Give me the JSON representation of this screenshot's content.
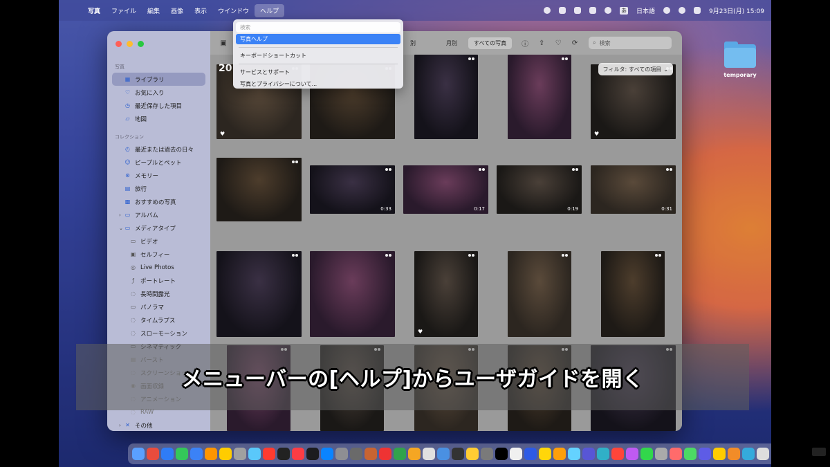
{
  "menubar": {
    "items": [
      {
        "label": "写真",
        "bold": true
      },
      {
        "label": "ファイル"
      },
      {
        "label": "編集"
      },
      {
        "label": "画像"
      },
      {
        "label": "表示"
      },
      {
        "label": "ウインドウ"
      },
      {
        "label": "ヘルプ",
        "active": true
      }
    ],
    "ime": "あ",
    "input_source": "日本語",
    "clock": "9月23日(月) 15:09"
  },
  "help_menu": {
    "search_placeholder": "検索",
    "items": [
      {
        "label": "写真ヘルプ",
        "selected": true
      },
      {
        "label": "キーボードショートカット"
      },
      {
        "label": "サービスとサポート"
      },
      {
        "label": "写真とプライバシーについて..."
      }
    ]
  },
  "sidebar": {
    "section_photos": "写真",
    "photos_items": [
      {
        "label": "ライブラリ",
        "icon": "library-icon",
        "selected": true
      },
      {
        "label": "お気に入り",
        "icon": "heart-icon"
      },
      {
        "label": "最近保存した項目",
        "icon": "clock-icon"
      },
      {
        "label": "地図",
        "icon": "map-icon"
      }
    ],
    "section_collections": "コレクション",
    "collection_items": [
      {
        "label": "最近または過去の日々",
        "icon": "calendar-icon"
      },
      {
        "label": "ピープルとペット",
        "icon": "person-icon"
      },
      {
        "label": "メモリー",
        "icon": "memories-icon"
      },
      {
        "label": "旅行",
        "icon": "suitcase-icon"
      },
      {
        "label": "おすすめの写真",
        "icon": "featured-icon"
      },
      {
        "label": "アルバム",
        "icon": "album-icon",
        "chevron": "›"
      },
      {
        "label": "メディアタイプ",
        "icon": "media-types-icon",
        "chevron": "⌄"
      }
    ],
    "media_items": [
      {
        "label": "ビデオ",
        "icon": "video-icon"
      },
      {
        "label": "セルフィー",
        "icon": "selfie-icon"
      },
      {
        "label": "Live Photos",
        "icon": "live-photo-icon"
      },
      {
        "label": "ポートレート",
        "icon": "portrait-icon"
      },
      {
        "label": "長時間露光",
        "icon": "long-exposure-icon"
      },
      {
        "label": "パノラマ",
        "icon": "panorama-icon"
      },
      {
        "label": "タイムラプス",
        "icon": "timelapse-icon"
      },
      {
        "label": "スローモーション",
        "icon": "slowmo-icon"
      },
      {
        "label": "シネマティック",
        "icon": "cinematic-icon"
      },
      {
        "label": "バースト",
        "icon": "burst-icon",
        "faded": true
      },
      {
        "label": "スクリーンショット",
        "icon": "screenshot-icon",
        "faded": true
      },
      {
        "label": "画面収録",
        "icon": "screen-recording-icon",
        "faded": true
      },
      {
        "label": "アニメーション",
        "icon": "animated-icon",
        "faded": true
      },
      {
        "label": "RAW",
        "icon": "raw-icon",
        "faded": true
      }
    ],
    "other": {
      "label": "その他",
      "icon": "other-icon",
      "chevron": "›"
    }
  },
  "toolbar": {
    "seg_day": "別",
    "seg_month": "月別",
    "seg_all": "すべての写真",
    "search_placeholder": "検索"
  },
  "grid": {
    "year": "20",
    "filter_label": "フィルタ:",
    "filter_value": "すべての項目",
    "durations": [
      "0:33",
      "0:17",
      "0:19",
      "0:31"
    ]
  },
  "desktop": {
    "folder_label": "temporary"
  },
  "caption": "メニューバーの[ヘルプ]からユーザガイドを開く",
  "colors": {
    "accent": "#3b82f6",
    "traffic_close": "#ff5f57",
    "traffic_min": "#febc2e",
    "traffic_max": "#28c840"
  }
}
